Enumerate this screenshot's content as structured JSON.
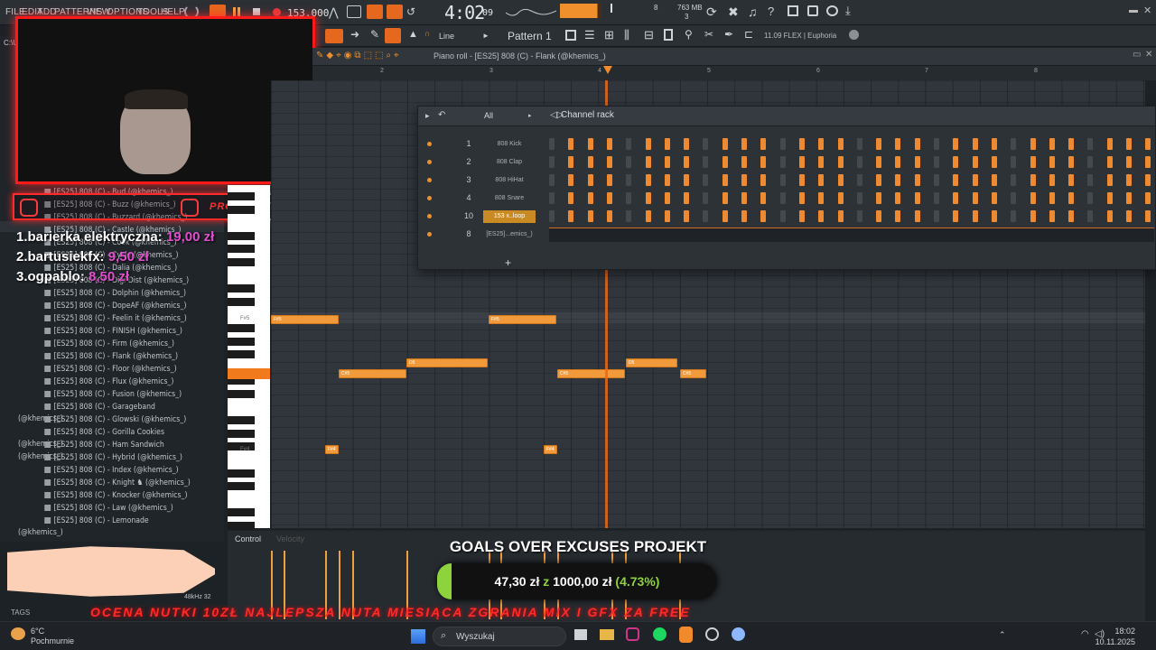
{
  "menubar": {
    "items": [
      "FILE",
      "EDIT",
      "ADD",
      "PATTERNS",
      "VIEW",
      "OPTIONS",
      "TOOLS",
      "HELP"
    ],
    "tempo": "153.000",
    "time": "4:02",
    "time_sub": "09",
    "memory": "763 MB",
    "mem_sub": "3",
    "cpu_val": "8"
  },
  "toolbar2": {
    "snap_label": "Line",
    "pattern_label": "Pattern 1",
    "hint": "11.09  FLEX | Euphoria"
  },
  "pianoroll": {
    "title": "Piano roll - [ES25] 808 (C) - Flank (@khemics_)",
    "bar_numbers": [
      "2",
      "3",
      "4",
      "5",
      "6",
      "7",
      "8"
    ],
    "key_labels": [
      "F#5",
      "F#5",
      "F#4"
    ]
  },
  "channelrack": {
    "filter": "All",
    "title": "Channel rack",
    "add_symbol": "+",
    "channels": [
      {
        "num": "1",
        "name": "808 Kick"
      },
      {
        "num": "2",
        "name": "808 Clap"
      },
      {
        "num": "3",
        "name": "808 HiHat"
      },
      {
        "num": "4",
        "name": "808 Snare"
      },
      {
        "num": "10",
        "name": "153 x..loop"
      },
      {
        "num": "8",
        "name": "[ES25]...emics_)"
      }
    ]
  },
  "notes_labels": {
    "fs5": "F#5",
    "cs5": "C#5",
    "cs5b": "C#5",
    "ds5": "D5",
    "fs4": "F#4"
  },
  "browser": {
    "path": "C:\\U",
    "items": [
      "[ES25] 808 (C) - Bud (@khemics_)",
      "[ES25] 808 (C) - Buzz (@khemics_)",
      "[ES25] 808 (C) - Buzzard (@khemics_)",
      "[ES25] 808 (C) - Castle (@khemics_)",
      "[ES25] 808 (C) - Cook (@khemics_)",
      "[ES25] 808 (C) - Cycle (@khemics_)",
      "[ES25] 808 (C) - Dalia (@khemics_)",
      "[ES25] 808 (C) - Digi Dist (@khemics_)",
      "[ES25] 808 (C) - Dolphin (@khemics_)",
      "[ES25] 808 (C) - DopeAF (@khemics_)",
      "[ES25] 808 (C) - Feelin it (@khemics_)",
      "[ES25] 808 (C) - FINISH (@khemics_)",
      "[ES25] 808 (C) - Firm (@khemics_)",
      "[ES25] 808 (C) - Flank (@khemics_)",
      "[ES25] 808 (C) - Floor (@khemics_)",
      "[ES25] 808 (C) - Flux (@khemics_)",
      "[ES25] 808 (C) - Fusion (@khemics_)",
      "[ES25] 808 (C) - Garageband (@khemics_)",
      "[ES25] 808 (C) - Glowski (@khemics_)",
      "[ES25] 808 (C) - Gorilla Cookies (@khemics_)",
      "[ES25] 808 (C) - Ham Sandwich (@khemics_)",
      "[ES25] 808 (C) - Hybrid (@khemics_)",
      "[ES25] 808 (C) - Index (@khemics_)",
      "[ES25] 808 (C) - Knight ♞ (@khemics_)",
      "[ES25] 808 (C) - Knocker (@khemics_)",
      "[ES25] 808 (C) - Law (@khemics_)",
      "[ES25] 808 (C) - Lemonade (@khemics_)"
    ],
    "selected_index": 13,
    "sample_info": "48kHz 32",
    "tags_label": "TAGS"
  },
  "overlay": {
    "donors": [
      {
        "name": "1.barierka elektryczna:",
        "amount": "19,00 zł"
      },
      {
        "name": "2.bartusiekfx:",
        "amount": "9,50 zł"
      },
      {
        "name": "3.ogpablo:",
        "amount": "8,50 zł"
      }
    ],
    "social_handle": "PROD_DEKER",
    "goal_title": "GOALS OVER EXCUSES PROJEKT",
    "goal_current": "47,30 zł",
    "goal_sep": "z",
    "goal_target": "1000,00 zł",
    "goal_percent": "(4.73%)",
    "goal_progress": 0.0473,
    "ticker": "OCENA NUTKI 10ZŁ  NAJLEPSZA NUTA MIESIĄCA ZGRANIA MIX I GFX ZA FREE"
  },
  "control": {
    "label": "Control",
    "sub": "Velocity"
  },
  "taskbar": {
    "weather_temp": "6°C",
    "weather_desc": "Pochmurnie",
    "search": "Wyszukaj",
    "clock_time": "18:02",
    "clock_date": "10.11.2025"
  },
  "colors": {
    "accent": "#f0902c",
    "purple": "#e14fcf",
    "neon_red": "#ff2a2a",
    "goal_green": "#8dd33c"
  }
}
